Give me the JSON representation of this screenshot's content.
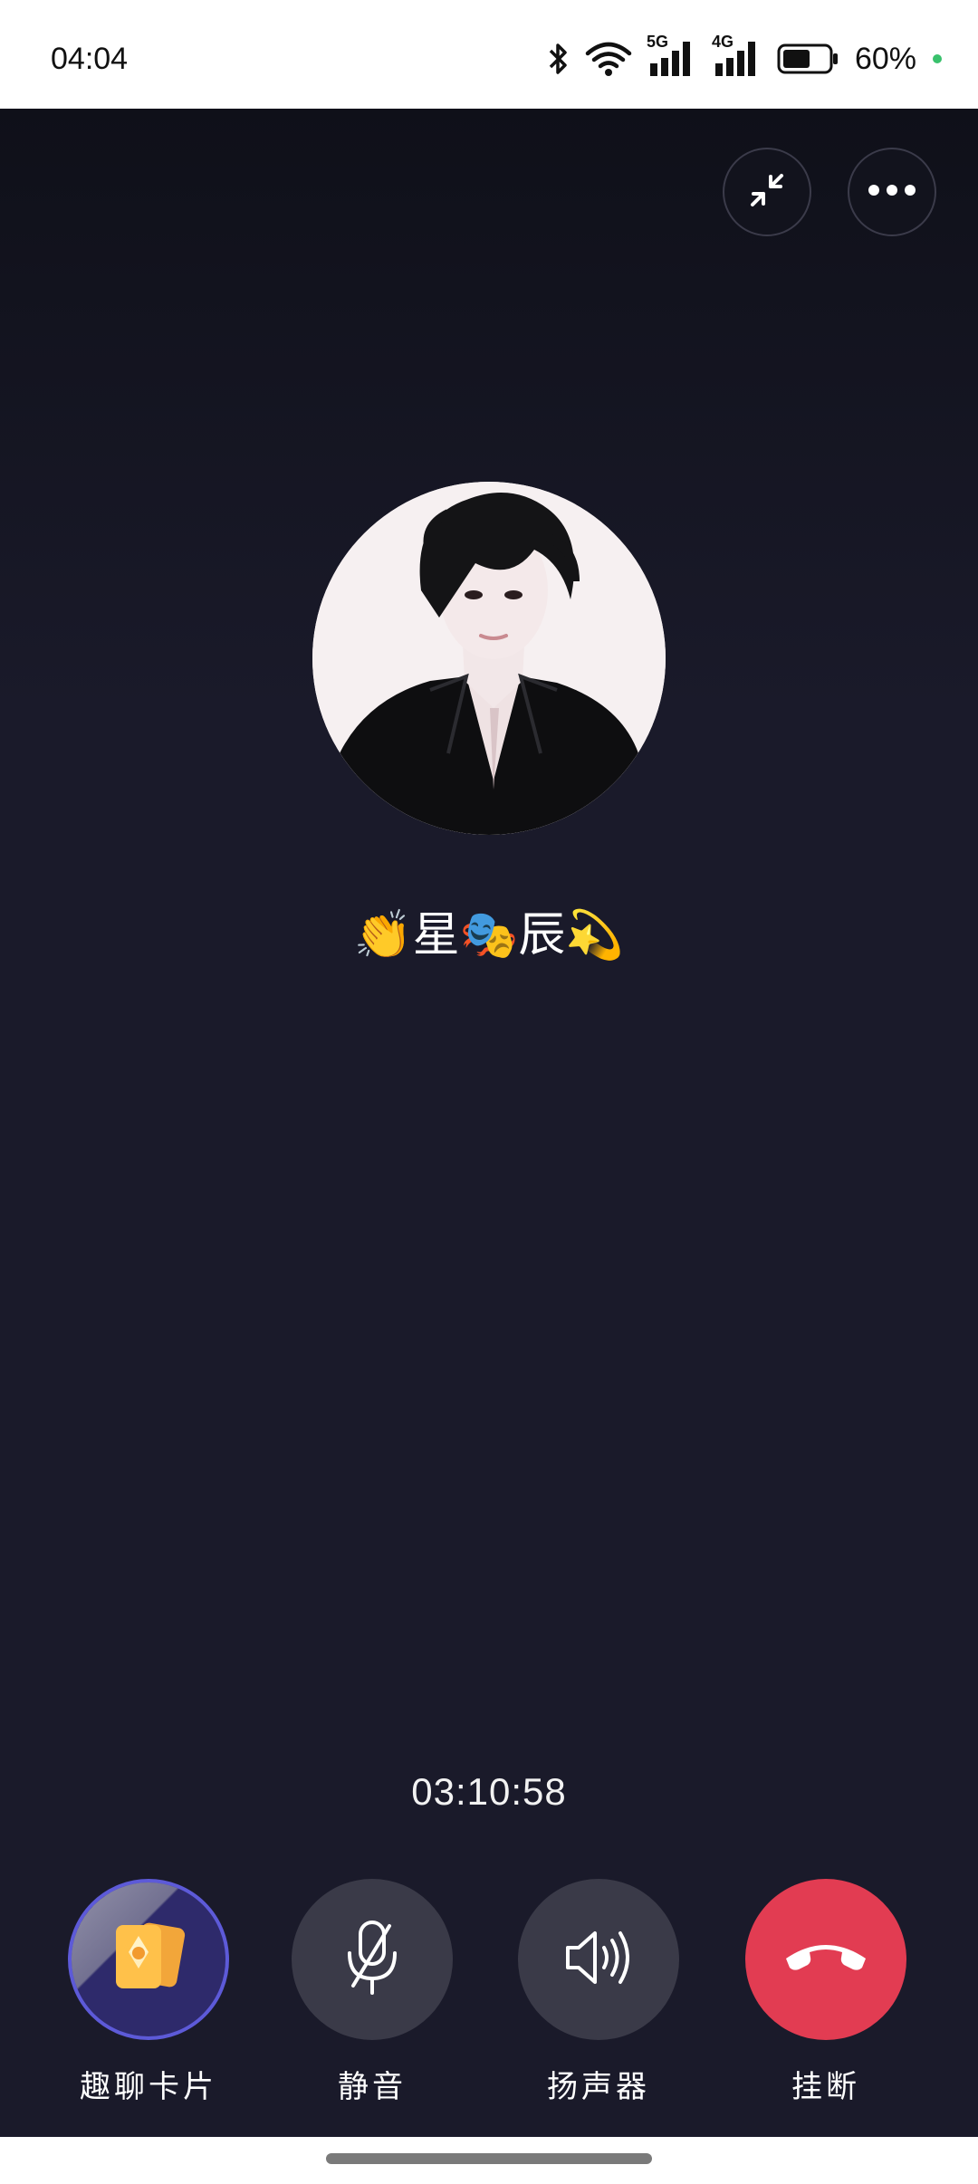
{
  "status_bar": {
    "time": "04:04",
    "signal_5g": "5G",
    "signal_4g": "4G",
    "battery_percent": "60%",
    "battery_level": 0.6
  },
  "call": {
    "caller_name": "👏星🎭辰💫",
    "duration": "03:10:58"
  },
  "top_actions": {
    "minimize_icon": "minimize-arrows-icon",
    "more_icon": "more-dots-icon"
  },
  "controls": [
    {
      "label": "趣聊卡片",
      "icon": "fun-chat-card-icon"
    },
    {
      "label": "静音",
      "icon": "microphone-muted-icon"
    },
    {
      "label": "扬声器",
      "icon": "speaker-icon"
    },
    {
      "label": "挂断",
      "icon": "hang-up-icon"
    }
  ],
  "colors": {
    "background": "#1a1a2a",
    "control_bg": "#3a3a48",
    "hangup": "#e23c52",
    "card_border": "#5d5ad8"
  }
}
